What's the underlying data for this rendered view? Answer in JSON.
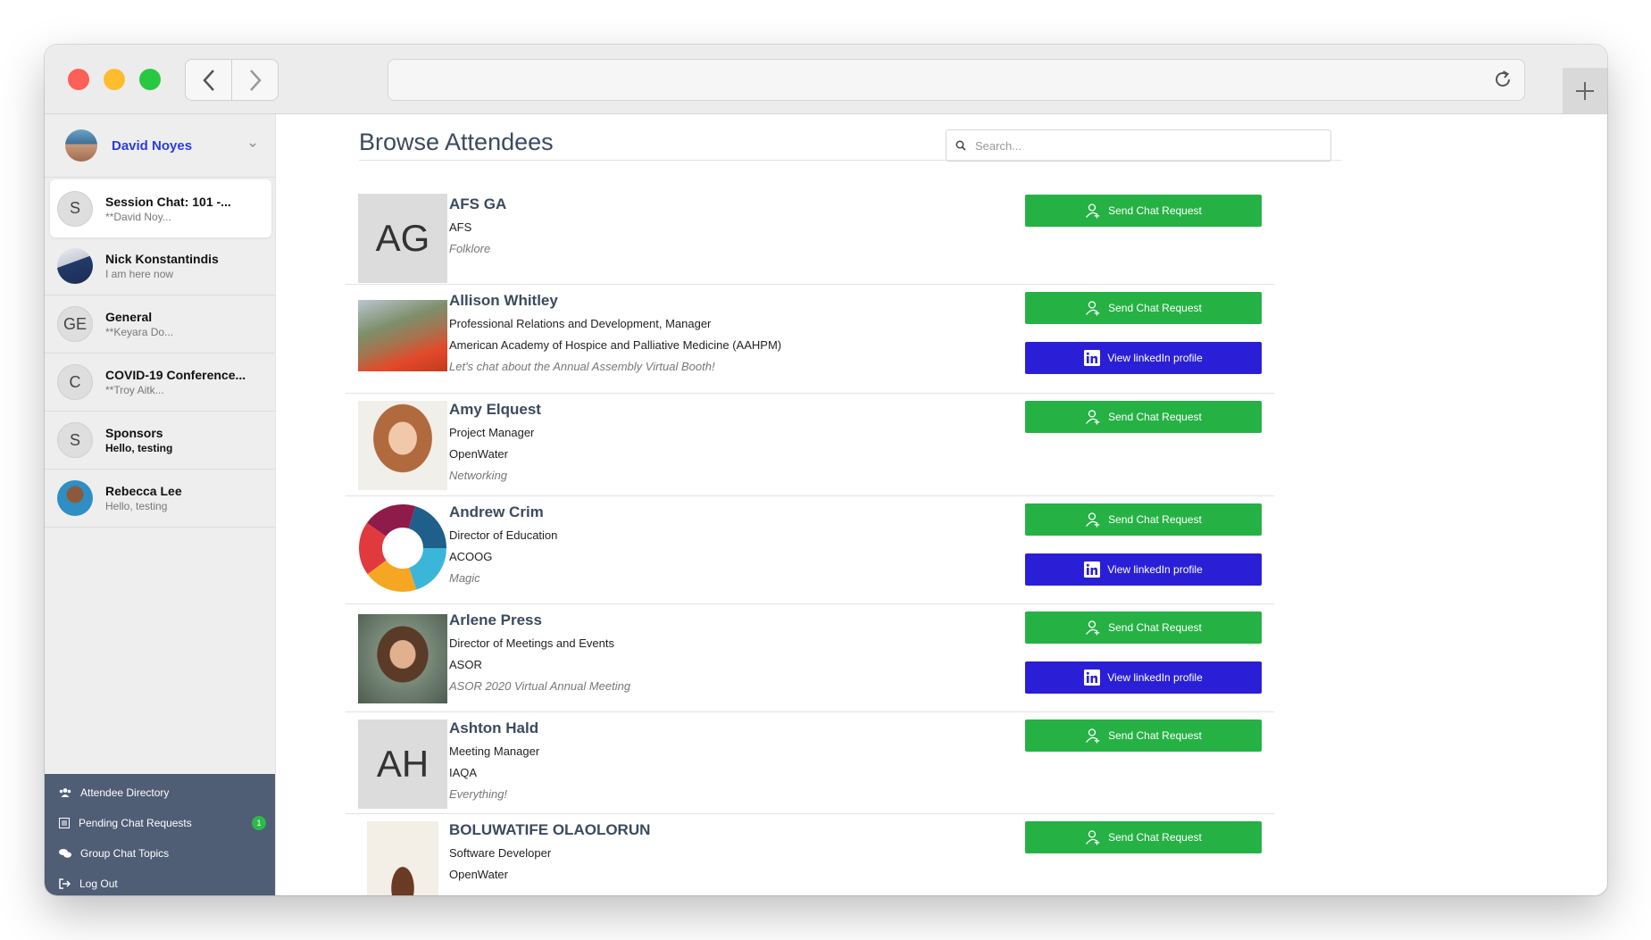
{
  "sidebar": {
    "user": {
      "name": "David Noyes"
    },
    "chats": [
      {
        "avatar": "S",
        "title": "Session Chat: 101 -...",
        "subtitle": "**David Noy...",
        "active": true
      },
      {
        "avatar": "",
        "title": "Nick Konstantindis",
        "subtitle": "I am here now"
      },
      {
        "avatar": "GE",
        "title": "General",
        "subtitle": "**Keyara Do..."
      },
      {
        "avatar": "C",
        "title": "COVID-19 Conference...",
        "subtitle": "**Troy Aitk..."
      },
      {
        "avatar": "S",
        "title": "Sponsors",
        "subtitle": "Hello, testing"
      },
      {
        "avatar": "",
        "title": "Rebecca Lee",
        "subtitle": "Hello, testing"
      }
    ],
    "menu": [
      {
        "label": "Attendee Directory",
        "icon": "users-icon"
      },
      {
        "label": "Pending Chat Requests",
        "icon": "list-icon",
        "badge": "1"
      },
      {
        "label": "Group Chat Topics",
        "icon": "chat-bubbles-icon"
      },
      {
        "label": "Log Out",
        "icon": "logout-icon"
      }
    ]
  },
  "main": {
    "title": "Browse Attendees",
    "search_placeholder": "Search...",
    "send_label": "Send Chat Request",
    "linkedin_label": "View linkedIn profile",
    "attendees": [
      {
        "initials": "AG",
        "name": "AFS GA",
        "lines": [
          "AFS"
        ],
        "note": "Folklore",
        "linkedin": false
      },
      {
        "initials": "",
        "name": "Allison Whitley",
        "lines": [
          "Professional Relations and Development, Manager",
          "American Academy of Hospice and Palliative Medicine (AAHPM)"
        ],
        "note": "Let's chat about the Annual Assembly Virtual Booth!",
        "linkedin": true
      },
      {
        "initials": "",
        "name": "Amy Elquest",
        "lines": [
          "Project Manager",
          "OpenWater"
        ],
        "note": "Networking",
        "linkedin": false
      },
      {
        "initials": "",
        "name": "Andrew Crim",
        "lines": [
          "Director of Education",
          "ACOOG"
        ],
        "note": "Magic",
        "linkedin": true
      },
      {
        "initials": "",
        "name": "Arlene Press",
        "lines": [
          "Director of Meetings and Events",
          "ASOR"
        ],
        "note": "ASOR 2020 Virtual Annual Meeting",
        "linkedin": true
      },
      {
        "initials": "AH",
        "name": "Ashton Hald",
        "lines": [
          "Meeting Manager",
          "IAQA"
        ],
        "note": "Everything!",
        "linkedin": false
      },
      {
        "initials": "",
        "name": "BOLUWATIFE OLAOLORUN",
        "lines": [
          "Software Developer",
          "OpenWater"
        ],
        "note": "",
        "linkedin": false
      }
    ]
  }
}
